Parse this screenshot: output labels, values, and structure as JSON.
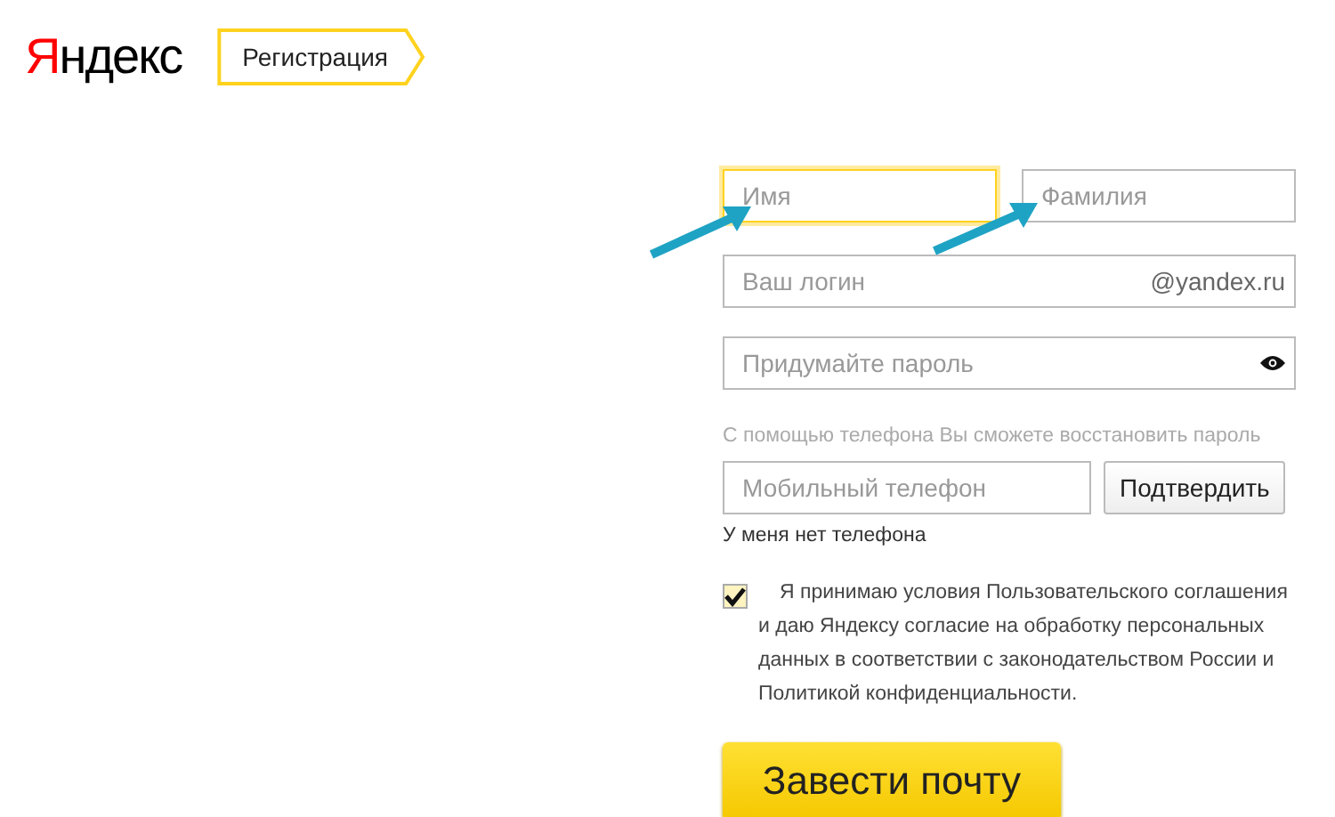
{
  "header": {
    "logo": "Яндекс",
    "page_title": "Регистрация"
  },
  "name_fields": [
    {
      "placeholder": "Имя",
      "focused": true
    },
    {
      "placeholder": "Фамилия",
      "focused": false
    }
  ],
  "login": {
    "placeholder": "Ваш логин",
    "suffix": "@yandex.ru"
  },
  "password": {
    "placeholder": "Придумайте пароль"
  },
  "phone_hint": "С помощью телефона Вы сможете восстановить пароль",
  "phone": {
    "placeholder": "Мобильный телефон",
    "button": "Подтвердить"
  },
  "no_phone_link": "У меня нет телефона",
  "agreement": {
    "checked": true,
    "text": "Я принимаю условия Пользовательского соглашения\n и даю Яндексу согласие на обработку персональных\nданных в соответствии с законодательством России и\nПолитикой конфиденциальности."
  },
  "submit": "Завести почту"
}
